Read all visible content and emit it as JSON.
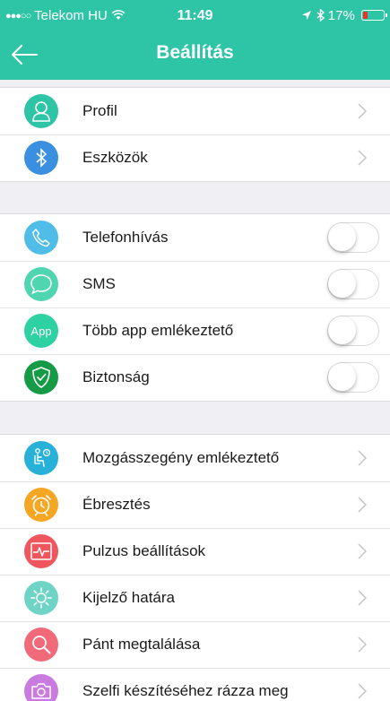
{
  "status_bar": {
    "carrier": "Telekom HU",
    "time": "11:49",
    "battery": "17%",
    "battery_color": "#e8342e"
  },
  "header": {
    "title": "Beállítás",
    "color": "#2ec4a6"
  },
  "section1": [
    {
      "label": "Profil",
      "icon": "profile-icon",
      "color": "#2ec4a6"
    },
    {
      "label": "Eszközök",
      "icon": "bluetooth-icon",
      "color": "#3a8fe0"
    }
  ],
  "section2": [
    {
      "label": "Telefonhívás",
      "icon": "phone-icon",
      "color": "#4fbde8",
      "toggle": false
    },
    {
      "label": "SMS",
      "icon": "sms-icon",
      "color": "#4fd6b0",
      "toggle": false
    },
    {
      "label": "Több app emlékeztető",
      "icon": "app-icon",
      "icon_text": "App",
      "color": "#2ed1a2",
      "toggle": false
    },
    {
      "label": "Biztonság",
      "icon": "shield-icon",
      "color": "#159a45",
      "toggle": false
    }
  ],
  "section3": [
    {
      "label": "Mozgásszegény emlékeztető",
      "icon": "sitting-icon",
      "color": "#27b0d8"
    },
    {
      "label": "Ébresztés",
      "icon": "alarm-icon",
      "color": "#f5a623"
    },
    {
      "label": "Pulzus beállítások",
      "icon": "heart-rate-icon",
      "color": "#f0565e"
    },
    {
      "label": "Kijelző határa",
      "icon": "brightness-icon",
      "color": "#6fd4c6"
    },
    {
      "label": "Pánt megtalálása",
      "icon": "search-icon",
      "color": "#f06a7a"
    },
    {
      "label": "Szelfi készítéséhez rázza meg",
      "icon": "camera-icon",
      "color": "#c97be0"
    }
  ]
}
